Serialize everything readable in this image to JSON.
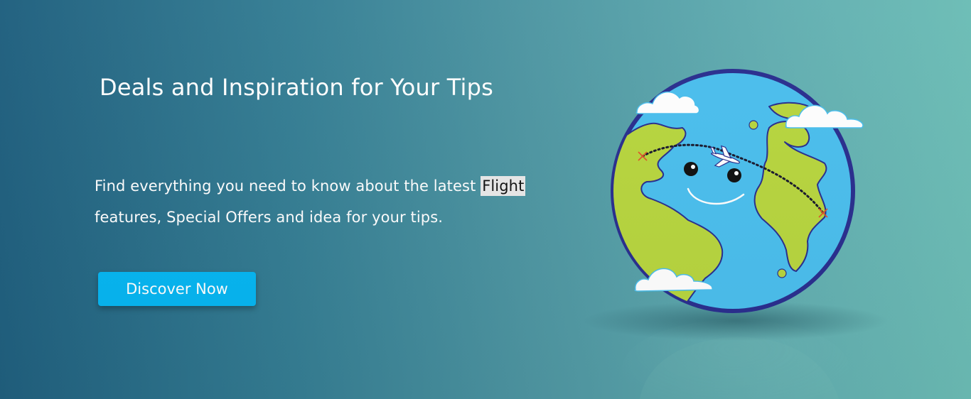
{
  "hero": {
    "title": "Deals and Inspiration for Your Tips",
    "description_before": "Find everything you need to know about the latest",
    "description_highlight": "Flight",
    "description_after": "features, Special Offers and idea for your tips.",
    "cta_label": "Discover Now"
  },
  "colors": {
    "background_left": "#20607f",
    "background_right": "#6cbdb6",
    "button": "#06b6f2",
    "globe_ocean": "#4bbfee",
    "globe_land": "#b8d63f",
    "globe_border": "#2a2f8f"
  },
  "illustration": {
    "name": "smiling-globe-with-airplane",
    "icons": [
      "cloud-icon",
      "airplane-icon",
      "flight-path-icon"
    ]
  }
}
